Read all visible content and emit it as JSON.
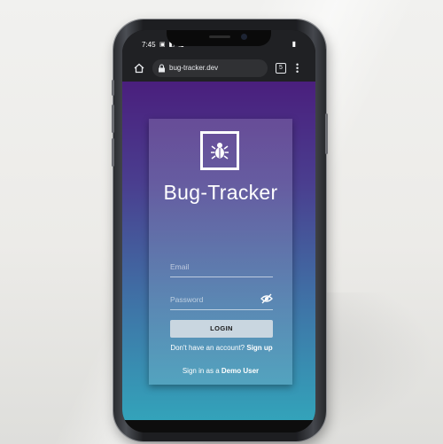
{
  "statusbar": {
    "time": "7:45",
    "icons": "▣ ◧ ◨ •",
    "right": "▮"
  },
  "browser": {
    "url": "bug-tracker.dev",
    "tab_count": "5"
  },
  "login": {
    "brand": "Bug-Tracker",
    "email_placeholder": "Email",
    "password_placeholder": "Password",
    "login_label": "LOGIN",
    "signup_prefix": "Don't have an account?",
    "signup_link": "Sign up",
    "demo_prefix": "Sign in as a",
    "demo_link": "Demo User"
  },
  "colors": {
    "page_top": "#4a1f7d",
    "page_bottom": "#33a3ba",
    "login_button": "#c9d6e0"
  },
  "icons": {
    "home": "home-icon",
    "lock": "lock-icon",
    "tabs": "tabs-icon",
    "menu": "more-vert-icon",
    "logo": "bug-icon",
    "password_visibility": "eye-off-icon"
  }
}
